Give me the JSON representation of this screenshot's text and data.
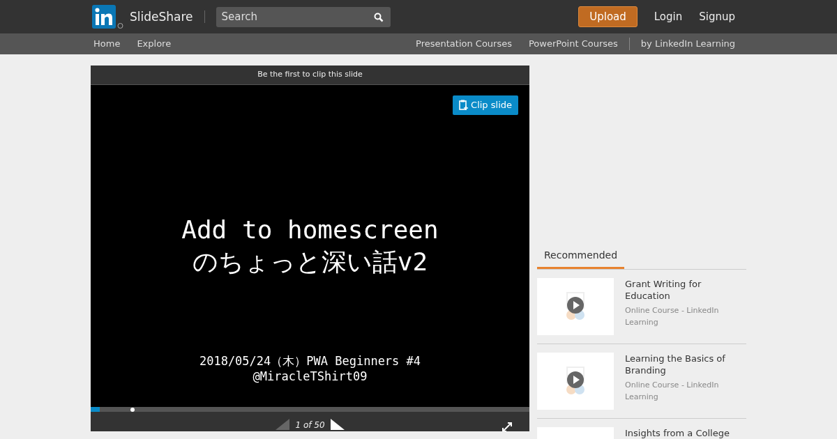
{
  "header": {
    "brand": "SlideShare",
    "search": {
      "placeholder": "Search"
    },
    "upload": "Upload",
    "links": [
      "Login",
      "Signup"
    ]
  },
  "subnav": {
    "left": [
      "Home",
      "Explore"
    ],
    "right": [
      "Presentation Courses",
      "PowerPoint Courses"
    ],
    "after_divider": "by LinkedIn Learning"
  },
  "player": {
    "clip_banner": "Be the first to clip this slide",
    "clip_button": "Clip slide",
    "slide": {
      "title_lines": [
        "Add to homescreen",
        "のちょっと深い話v2"
      ],
      "footer_lines": [
        "2018/05/24（木）PWA Beginners #4",
        "@MiracleTShirt09"
      ]
    },
    "progress": {
      "level": 0.02
    },
    "marker": {
      "level": 0.09
    },
    "prev_disabled": true,
    "counter": "1 of 50"
  },
  "sidebar": {
    "tab": "Recommended",
    "items": [
      {
        "title": "Grant Writing for Education",
        "subtitle": "Online Course - LinkedIn Learning"
      },
      {
        "title": "Learning the Basics of Branding",
        "subtitle": "Online Course - LinkedIn Learning"
      },
      {
        "title": "Insights from a College"
      }
    ]
  }
}
